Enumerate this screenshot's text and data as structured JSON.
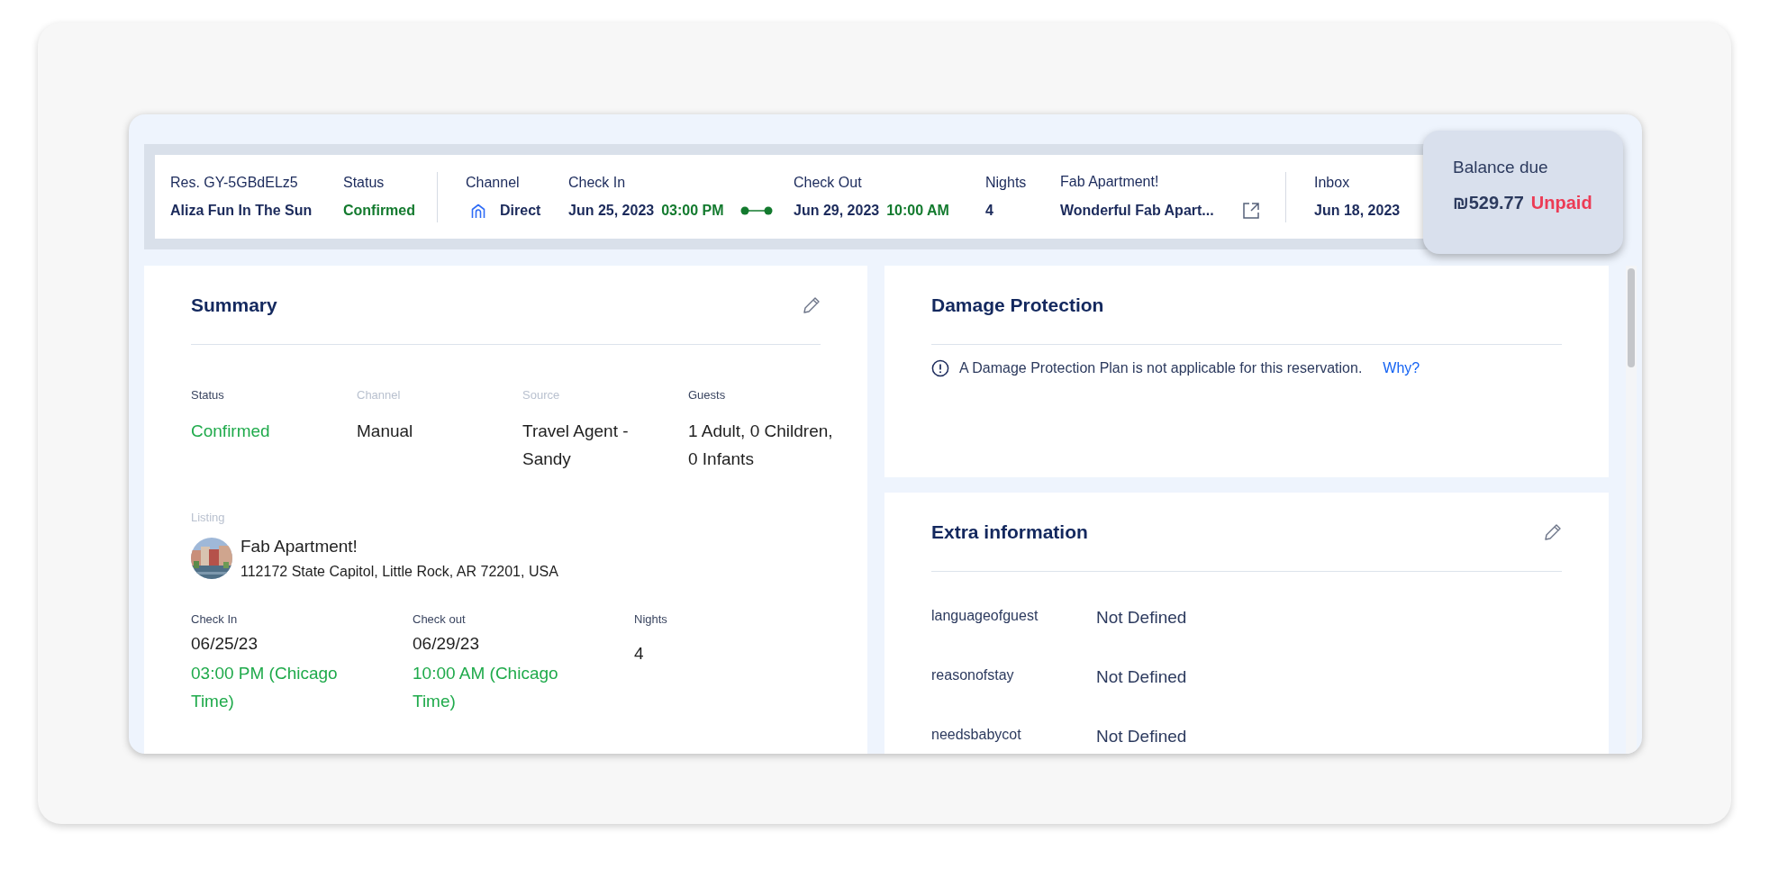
{
  "header": {
    "reservation": "Res. GY-5GBdELz5",
    "guest": "Aliza Fun In The Sun",
    "status": {
      "label": "Status",
      "value": "Confirmed"
    },
    "channel": {
      "label": "Channel",
      "value": "Direct"
    },
    "check_in": {
      "label": "Check In",
      "date": "Jun 25, 2023",
      "time": "03:00 PM"
    },
    "check_out": {
      "label": "Check Out",
      "date": "Jun 29, 2023",
      "time": "10:00 AM"
    },
    "nights": {
      "label": "Nights",
      "value": "4"
    },
    "listing": {
      "label": "Fab Apartment!",
      "value": "Wonderful Fab Apart..."
    },
    "inbox": {
      "label": "Inbox",
      "value": "Jun 18, 2023"
    }
  },
  "balance": {
    "label": "Balance due",
    "amount": "₪529.77",
    "state": "Unpaid"
  },
  "summary": {
    "title": "Summary",
    "fields": [
      {
        "label": "Status",
        "value": "Confirmed",
        "muted": false,
        "highlight": true
      },
      {
        "label": "Channel",
        "value": "Manual",
        "muted": true,
        "highlight": false
      },
      {
        "label": "Source",
        "value": "Travel Agent - Sandy",
        "muted": true,
        "highlight": false
      },
      {
        "label": "Guests",
        "value": "1 Adult, 0 Children, 0 Infants",
        "muted": false,
        "highlight": false
      }
    ],
    "listing": {
      "label": "Listing",
      "name": "Fab Apartment!",
      "address": "112172 State Capitol, Little Rock, AR 72201, USA"
    },
    "dates": [
      {
        "label": "Check In",
        "date": "06/25/23",
        "time": "03:00 PM (Chicago Time)"
      },
      {
        "label": "Check out",
        "date": "06/29/23",
        "time": "10:00 AM (Chicago Time)"
      }
    ],
    "nights": {
      "label": "Nights",
      "value": "4"
    }
  },
  "damage_protection": {
    "title": "Damage Protection",
    "notice": "A Damage Protection Plan is not applicable for this reservation.",
    "link": "Why?"
  },
  "extra_information": {
    "title": "Extra information",
    "rows": [
      {
        "key": "languageofguest",
        "value": "Not Defined"
      },
      {
        "key": "reasonofstay",
        "value": "Not Defined"
      },
      {
        "key": "needsbabycot",
        "value": "Not Defined"
      }
    ]
  }
}
